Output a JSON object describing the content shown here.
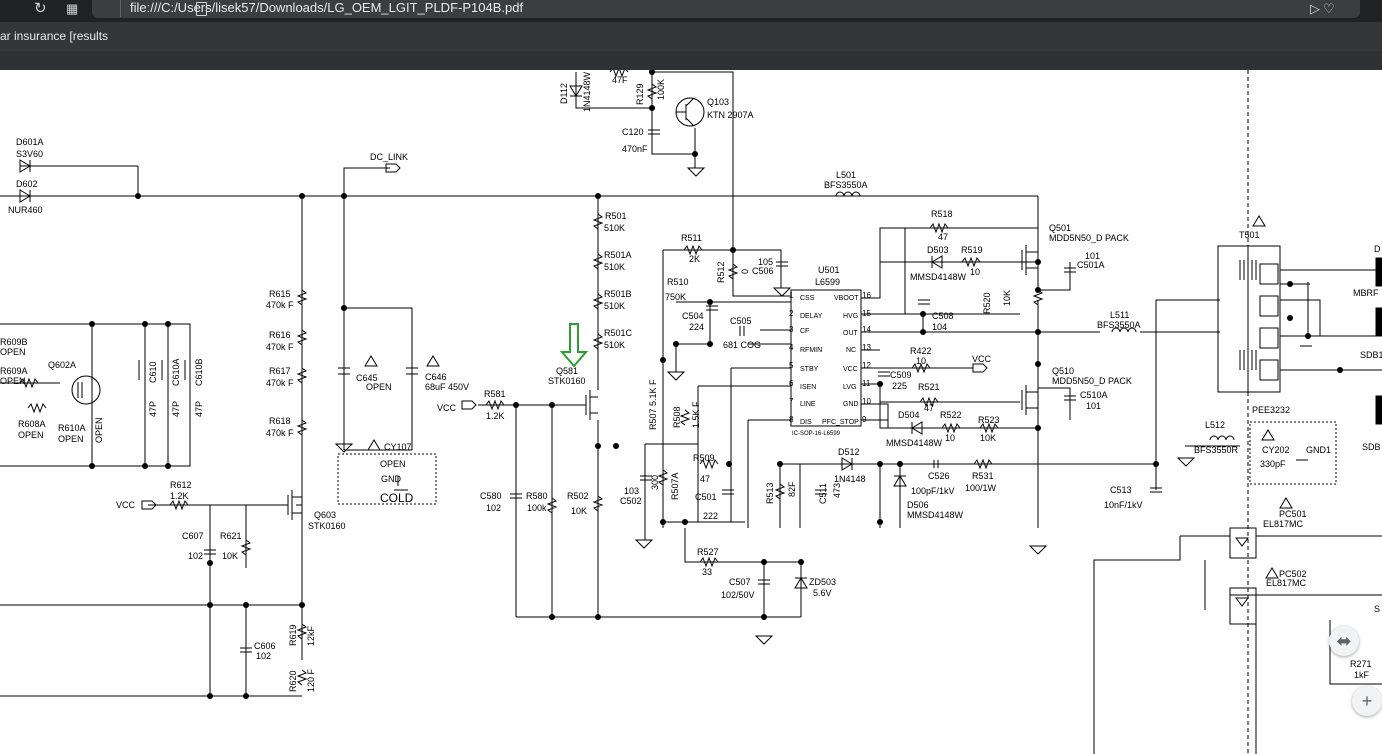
{
  "browser": {
    "url": "file:///C:/Users/lisek57/Downloads/LG_OEM_LGIT_PLDF-P104B.pdf",
    "bookmark": "ar insurance [results",
    "icons": [
      "refresh-icon",
      "grid-icon",
      "page-icon",
      "share-icon",
      "heart-icon"
    ]
  },
  "schematic": {
    "components": [
      {
        "ref": "D601A",
        "value": "S3V60"
      },
      {
        "ref": "D602",
        "value": "NUR460"
      },
      {
        "ref": "DC_LINK",
        "value": ""
      },
      {
        "ref": "R615",
        "value": "470k F"
      },
      {
        "ref": "R616",
        "value": "470k F"
      },
      {
        "ref": "R617",
        "value": "470k F"
      },
      {
        "ref": "R618",
        "value": "470k F"
      },
      {
        "ref": "R609B",
        "value": "OPEN"
      },
      {
        "ref": "R609A",
        "value": "OPEN"
      },
      {
        "ref": "Q602A",
        "value": ""
      },
      {
        "ref": "R608A",
        "value": "OPEN"
      },
      {
        "ref": "R610A",
        "value": "OPEN"
      },
      {
        "ref": "C610",
        "value": "47P"
      },
      {
        "ref": "C610A",
        "value": "47P"
      },
      {
        "ref": "C610B",
        "value": "47P"
      },
      {
        "ref": "C645",
        "value": "OPEN"
      },
      {
        "ref": "C646",
        "value": "68uF 450V"
      },
      {
        "ref": "CY107",
        "value": "OPEN"
      },
      {
        "ref": "R612",
        "value": "1.2K"
      },
      {
        "ref": "Q603",
        "value": "STK0160"
      },
      {
        "ref": "C607",
        "value": "102"
      },
      {
        "ref": "R621",
        "value": "10K"
      },
      {
        "ref": "C606",
        "value": "102"
      },
      {
        "ref": "R619",
        "value": "12kF"
      },
      {
        "ref": "R620",
        "value": "120 F"
      },
      {
        "ref": "R581",
        "value": "1.2K"
      },
      {
        "ref": "Q581",
        "value": "STK0160"
      },
      {
        "ref": "C580",
        "value": "102"
      },
      {
        "ref": "R580",
        "value": "100k"
      },
      {
        "ref": "R502",
        "value": "10K"
      },
      {
        "ref": "R501",
        "value": "510K"
      },
      {
        "ref": "R501A",
        "value": "510K"
      },
      {
        "ref": "R501B",
        "value": "510K"
      },
      {
        "ref": "R501C",
        "value": "510K"
      },
      {
        "ref": "D112",
        "value": "1N4148W"
      },
      {
        "ref": "R129",
        "value": "100K"
      },
      {
        "ref": "Q103",
        "value": "KTN 2907A"
      },
      {
        "ref": "C120",
        "value": "470nF"
      },
      {
        "ref": "L501",
        "value": "BFS3550A"
      },
      {
        "ref": "R511",
        "value": "2K"
      },
      {
        "ref": "R512",
        "value": "0"
      },
      {
        "ref": "C506",
        "value": "105"
      },
      {
        "ref": "R510",
        "value": "750K"
      },
      {
        "ref": "C504",
        "value": "224"
      },
      {
        "ref": "C505",
        "value": "681 COG"
      },
      {
        "ref": "U501",
        "value": "L6599"
      },
      {
        "ref": "R518",
        "value": "47"
      },
      {
        "ref": "D503",
        "value": "MMSD4148W"
      },
      {
        "ref": "R519",
        "value": "10"
      },
      {
        "ref": "R520",
        "value": "10K"
      },
      {
        "ref": "C508",
        "value": "104"
      },
      {
        "ref": "Q501",
        "value": "MDD5N50_D PACK"
      },
      {
        "ref": "C501A",
        "value": "101"
      },
      {
        "ref": "L511",
        "value": "BFS3550A"
      },
      {
        "ref": "R422",
        "value": "10"
      },
      {
        "ref": "C509",
        "value": "225"
      },
      {
        "ref": "R521",
        "value": "47"
      },
      {
        "ref": "D504",
        "value": "MMSD4148W"
      },
      {
        "ref": "R522",
        "value": "10"
      },
      {
        "ref": "R523",
        "value": "10K"
      },
      {
        "ref": "Q510",
        "value": "MDD5N50_D PACK"
      },
      {
        "ref": "C510A",
        "value": "101"
      },
      {
        "ref": "R507",
        "value": "5.1K F"
      },
      {
        "ref": "R508",
        "value": "1.5K F"
      },
      {
        "ref": "R509",
        "value": "47"
      },
      {
        "ref": "C501",
        "value": "222"
      },
      {
        "ref": "C502",
        "value": "103"
      },
      {
        "ref": "R507A",
        "value": "300"
      },
      {
        "ref": "D512",
        "value": "1N4148"
      },
      {
        "ref": "R513",
        "value": "82F"
      },
      {
        "ref": "C511",
        "value": "473"
      },
      {
        "ref": "D506",
        "value": "MMSD4148W"
      },
      {
        "ref": "C526",
        "value": "100pF/1kV"
      },
      {
        "ref": "R531",
        "value": "100/1W"
      },
      {
        "ref": "C513",
        "value": "10nF/1kV"
      },
      {
        "ref": "R527",
        "value": "33"
      },
      {
        "ref": "C507",
        "value": "102/50V"
      },
      {
        "ref": "ZD503",
        "value": "5.6V"
      },
      {
        "ref": "T501",
        "value": "PEE3232"
      },
      {
        "ref": "L512",
        "value": "BFS3550R"
      },
      {
        "ref": "CY202",
        "value": "330pF"
      },
      {
        "ref": "PC501",
        "value": "EL817MC"
      },
      {
        "ref": "PC502",
        "value": "EL817MC"
      },
      {
        "ref": "R271",
        "value": "1kF"
      }
    ],
    "labels": {
      "d601a": "D601A",
      "s3v60": "S3V60",
      "d602": "D602",
      "nur460": "NUR460",
      "dclink": "DC_LINK",
      "r615": "R615",
      "r616": "R616",
      "r617": "R617",
      "r618": "R618",
      "r470kf": "470k F",
      "r609b": "R609B",
      "r609a": "R609A",
      "open": "OPEN",
      "q602a": "Q602A",
      "r608a": "R608A",
      "r610a": "R610A",
      "c610": "C610",
      "c610a": "C610A",
      "c610b": "C610B",
      "p47": "47P",
      "c645": "C645",
      "c646": "C646",
      "c646v": "68uF 450V",
      "cy107": "CY107",
      "gnd": "GND",
      "cold": "COLD",
      "r612": "R612",
      "k12": "1.2K",
      "vcc": "VCC",
      "q603": "Q603",
      "stk0160": "STK0160",
      "c607": "C607",
      "v102": "102",
      "r621": "R621",
      "k10": "10K",
      "c606": "C606",
      "r619": "R619",
      "r619v": "12kF",
      "r620": "R620",
      "r620v": "120 F",
      "r581": "R581",
      "q581": "Q581",
      "c580": "C580",
      "r580": "R580",
      "k100": "100k",
      "r502": "R502",
      "r501": "R501",
      "r501a": "R501A",
      "r501b": "R501B",
      "r501c": "R501C",
      "k510": "510K",
      "d112": "D112",
      "n4148w": "1N4148W",
      "f47": "47F",
      "r129": "R129",
      "k100b": "100K",
      "q103": "Q103",
      "ktn": "KTN 2907A",
      "c120": "C120",
      "nf470": "470nF",
      "l501": "L501",
      "bfs3550a": "BFS3550A",
      "r511": "R511",
      "k2": "2K",
      "r512": "R512",
      "zero": "0",
      "v105": "105",
      "c506": "C506",
      "r510": "R510",
      "k750": "750K",
      "c504": "C504",
      "v224": "224",
      "c505": "C505",
      "cog": "681 COG",
      "u501": "U501",
      "l6599": "L6599",
      "ic": "IC-SOP-16-L6599",
      "css": "CSS",
      "delay": "DELAY",
      "cf": "CF",
      "rfmin": "RFMIN",
      "stby": "STBY",
      "isen": "ISEN",
      "line": "LINE",
      "dis": "DIS",
      "vboot": "VBOOT",
      "hvg": "HVG",
      "out": "OUT",
      "nc": "NC",
      "vcc2": "VCC",
      "lvg": "LVG",
      "gnd2": "GND",
      "pfc": "PFC_STOP",
      "p1": "1",
      "p2": "2",
      "p3": "3",
      "p4": "4",
      "p5": "5",
      "p6": "6",
      "p7": "7",
      "p8": "8",
      "p9": "9",
      "p10": "10",
      "p11": "11",
      "p12": "12",
      "p13": "13",
      "p14": "14",
      "p15": "15",
      "p16": "16",
      "r518": "R518",
      "v47": "47",
      "d503": "D503",
      "r519": "R519",
      "v10": "10",
      "mmsd": "MMSD4148W",
      "r520": "R520",
      "c508": "C508",
      "v104": "104",
      "q501": "Q501",
      "mdd": "MDD5N50_D PACK",
      "v101": "101",
      "c501a": "C501A",
      "l511": "L511",
      "r422": "R422",
      "c509": "C509",
      "v225": "225",
      "r521": "R521",
      "d504": "D504",
      "r522": "R522",
      "r523": "R523",
      "q510": "Q510",
      "c510a": "C510A",
      "r507": "R507",
      "r507v": "5.1K F",
      "r508": "R508",
      "r508v": "1.5K F",
      "r509": "R509",
      "c501": "C501",
      "v222": "222",
      "v103": "103",
      "c502": "C502",
      "v300": "300",
      "r507a": "R507A",
      "d512": "D512",
      "n4148": "1N4148",
      "r513": "R513",
      "f82": "82F",
      "c511": "C511",
      "v473": "473",
      "d506": "D506",
      "c526": "C526",
      "c526v": "100pF/1kV",
      "r531": "R531",
      "r531v": "100/1W",
      "c513": "C513",
      "c513v": "10nF/1kV",
      "r527": "R527",
      "v33": "33",
      "c507": "C507",
      "c507v": "102/50V",
      "zd503": "ZD503",
      "v56": "5.6V",
      "t501": "T501",
      "pee": "PEE3232",
      "l512": "L512",
      "bfs3550r": "BFS3550R",
      "cy202": "CY202",
      "pf330": "330pF",
      "gnd1": "GND1",
      "pc501": "PC501",
      "el817": "EL817MC",
      "pc502": "PC502",
      "r271": "R271",
      "kf1": "1kF",
      "mbrf": "MBRF",
      "sdb1": "SDB1",
      "sdb": "SDB",
      "d": "D",
      "s": "S"
    }
  }
}
